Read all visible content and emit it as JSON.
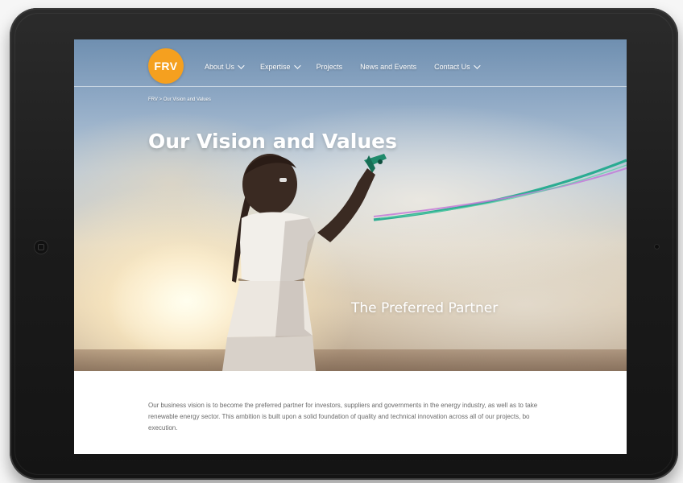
{
  "site": {
    "logo_text": "FRV",
    "brand_color": "#f5a01f"
  },
  "nav": {
    "items": [
      {
        "label": "About Us",
        "has_dropdown": true
      },
      {
        "label": "Expertise",
        "has_dropdown": true
      },
      {
        "label": "Projects",
        "has_dropdown": false
      },
      {
        "label": "News and Events",
        "has_dropdown": false
      },
      {
        "label": "Contact Us",
        "has_dropdown": true
      }
    ]
  },
  "breadcrumb": {
    "text": "FRV > Our Vision and Values"
  },
  "hero": {
    "title": "Our Vision and Values",
    "tagline": "The Preferred Partner"
  },
  "content": {
    "intro_text": "Our business vision is to become the preferred partner for investors, suppliers and governments in the energy industry, as well as to take\nrenewable energy sector.  This ambition is built upon a solid foundation of quality and technical innovation across all of our projects, bo\nexecution."
  },
  "device": {
    "frame_color": "#1b1b1b"
  }
}
